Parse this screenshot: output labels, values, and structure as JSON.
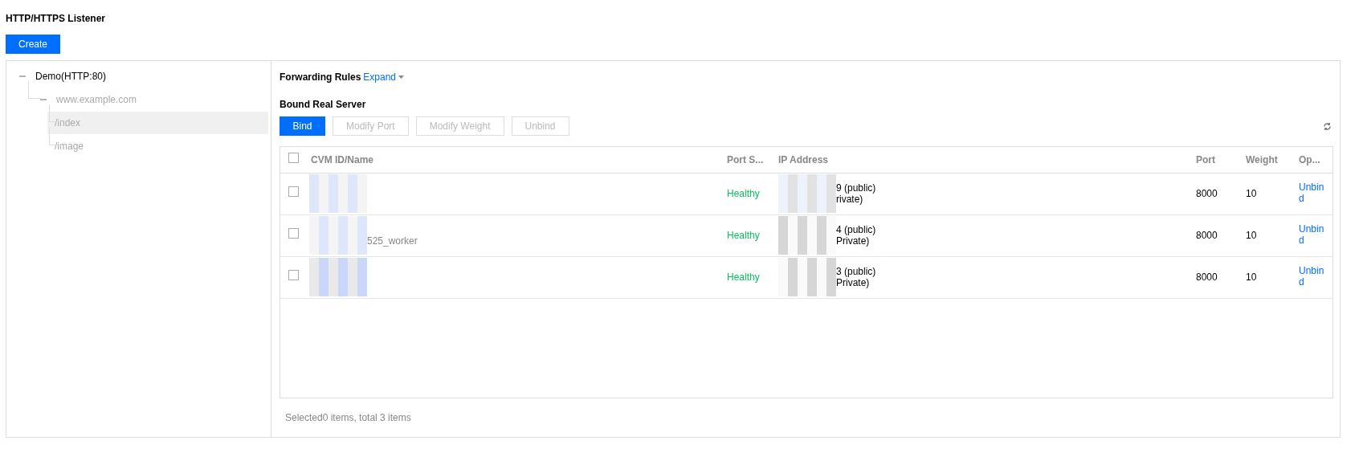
{
  "page_title": "HTTP/HTTPS Listener",
  "create_button": "Create",
  "tree": [
    {
      "label": "Demo(HTTP:80)",
      "expanded": true,
      "children": [
        {
          "label": "www.example.com",
          "expanded": true,
          "children": [
            {
              "label": "/index",
              "selected": true
            },
            {
              "label": "/image",
              "selected": false
            }
          ]
        }
      ]
    }
  ],
  "forwarding_rules": {
    "title": "Forwarding Rules",
    "link": "Expand"
  },
  "bound_section": {
    "title": "Bound Real Server"
  },
  "toolbar": [
    {
      "label": "Bind",
      "disabled": false
    },
    {
      "label": "Modify Port",
      "disabled": true
    },
    {
      "label": "Modify Weight",
      "disabled": true
    },
    {
      "label": "Unbind",
      "disabled": true
    }
  ],
  "table": {
    "header_checked": false,
    "columns": [
      "CVM ID/Name",
      "Port S...",
      "IP Address",
      "Port",
      "Weight",
      "Op..."
    ],
    "rows": [
      {
        "checked": false,
        "name_lines": [],
        "status": "Healthy",
        "ip_lines": [
          "9 (public)",
          "rivate)"
        ],
        "port": "8000",
        "weight": "10",
        "action": "Unbind"
      },
      {
        "checked": false,
        "name_lines": [
          "525_worker"
        ],
        "status": "Healthy",
        "ip_lines": [
          "4 (public)",
          "Private)"
        ],
        "port": "8000",
        "weight": "10",
        "action": "Unbind"
      },
      {
        "checked": false,
        "name_lines": [],
        "status": "Healthy",
        "ip_lines": [
          "3 (public)",
          "Private)"
        ],
        "port": "8000",
        "weight": "10",
        "action": "Unbind"
      }
    ]
  },
  "footer": "Selected0 items, total 3 items"
}
